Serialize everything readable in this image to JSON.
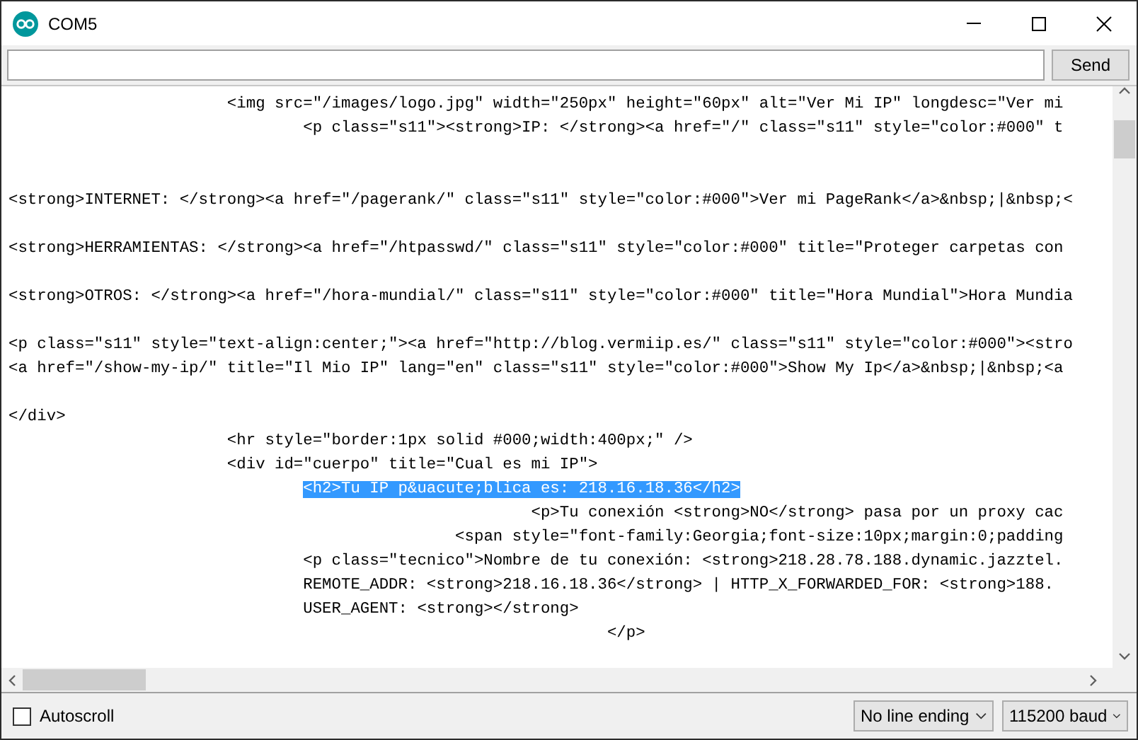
{
  "window": {
    "title": "COM5"
  },
  "send_bar": {
    "button": "Send"
  },
  "output": {
    "lines": [
      {
        "kind": "code",
        "selected": false,
        "text": "                       <img src=\"/images/logo.jpg\" width=\"250px\" height=\"60px\" alt=\"Ver Mi IP\" longdesc=\"Ver mi"
      },
      {
        "kind": "code",
        "selected": false,
        "text": "                               <p class=\"s11\"><strong>IP: </strong><a href=\"/\" class=\"s11\" style=\"color:#000\" t"
      },
      {
        "kind": "blank"
      },
      {
        "kind": "blank"
      },
      {
        "kind": "code",
        "selected": false,
        "text": "<strong>INTERNET: </strong><a href=\"/pagerank/\" class=\"s11\" style=\"color:#000\">Ver mi PageRank</a>&nbsp;|&nbsp;<"
      },
      {
        "kind": "blank"
      },
      {
        "kind": "code",
        "selected": false,
        "text": "<strong>HERRAMIENTAS: </strong><a href=\"/htpasswd/\" class=\"s11\" style=\"color:#000\" title=\"Proteger carpetas con"
      },
      {
        "kind": "blank"
      },
      {
        "kind": "code",
        "selected": false,
        "text": "<strong>OTROS: </strong><a href=\"/hora-mundial/\" class=\"s11\" style=\"color:#000\" title=\"Hora Mundial\">Hora Mundia"
      },
      {
        "kind": "blank"
      },
      {
        "kind": "code",
        "selected": false,
        "text": "<p class=\"s11\" style=\"text-align:center;\"><a href=\"http://blog.vermiip.es/\" class=\"s11\" style=\"color:#000\"><stro"
      },
      {
        "kind": "code",
        "selected": false,
        "text": "<a href=\"/show-my-ip/\" title=\"Il Mio IP\" lang=\"en\" class=\"s11\" style=\"color:#000\">Show My Ip</a>&nbsp;|&nbsp;<a"
      },
      {
        "kind": "blank"
      },
      {
        "kind": "code",
        "selected": false,
        "text": "</div>"
      },
      {
        "kind": "code",
        "selected": false,
        "text": "                       <hr style=\"border:1px solid #000;width:400px;\" />"
      },
      {
        "kind": "code",
        "selected": false,
        "text": "                       <div id=\"cuerpo\" title=\"Cual es mi IP\">"
      },
      {
        "kind": "code",
        "selected": true,
        "text": "                               <h2>Tu IP p&uacute;blica es: 218.16.18.36</h2>"
      },
      {
        "kind": "code",
        "selected": false,
        "text": "                                                       <p>Tu conexión <strong>NO</strong> pasa por un proxy cac"
      },
      {
        "kind": "code",
        "selected": false,
        "text": "                                               <span style=\"font-family:Georgia;font-size:10px;margin:0;padding"
      },
      {
        "kind": "code",
        "selected": false,
        "text": "                               <p class=\"tecnico\">Nombre de tu conexión: <strong>218.28.78.188.dynamic.jazztel."
      },
      {
        "kind": "code",
        "selected": false,
        "text": "                               REMOTE_ADDR: <strong>218.16.18.36</strong> | HTTP_X_FORWARDED_FOR: <strong>188."
      },
      {
        "kind": "code",
        "selected": false,
        "text": "                               USER_AGENT: <strong></strong>"
      },
      {
        "kind": "code",
        "selected": false,
        "text": "                                                               </p>"
      }
    ]
  },
  "status_bar": {
    "autoscroll": {
      "label": "Autoscroll",
      "checked": false
    },
    "line_ending": "No line ending",
    "baud": "115200 baud"
  }
}
